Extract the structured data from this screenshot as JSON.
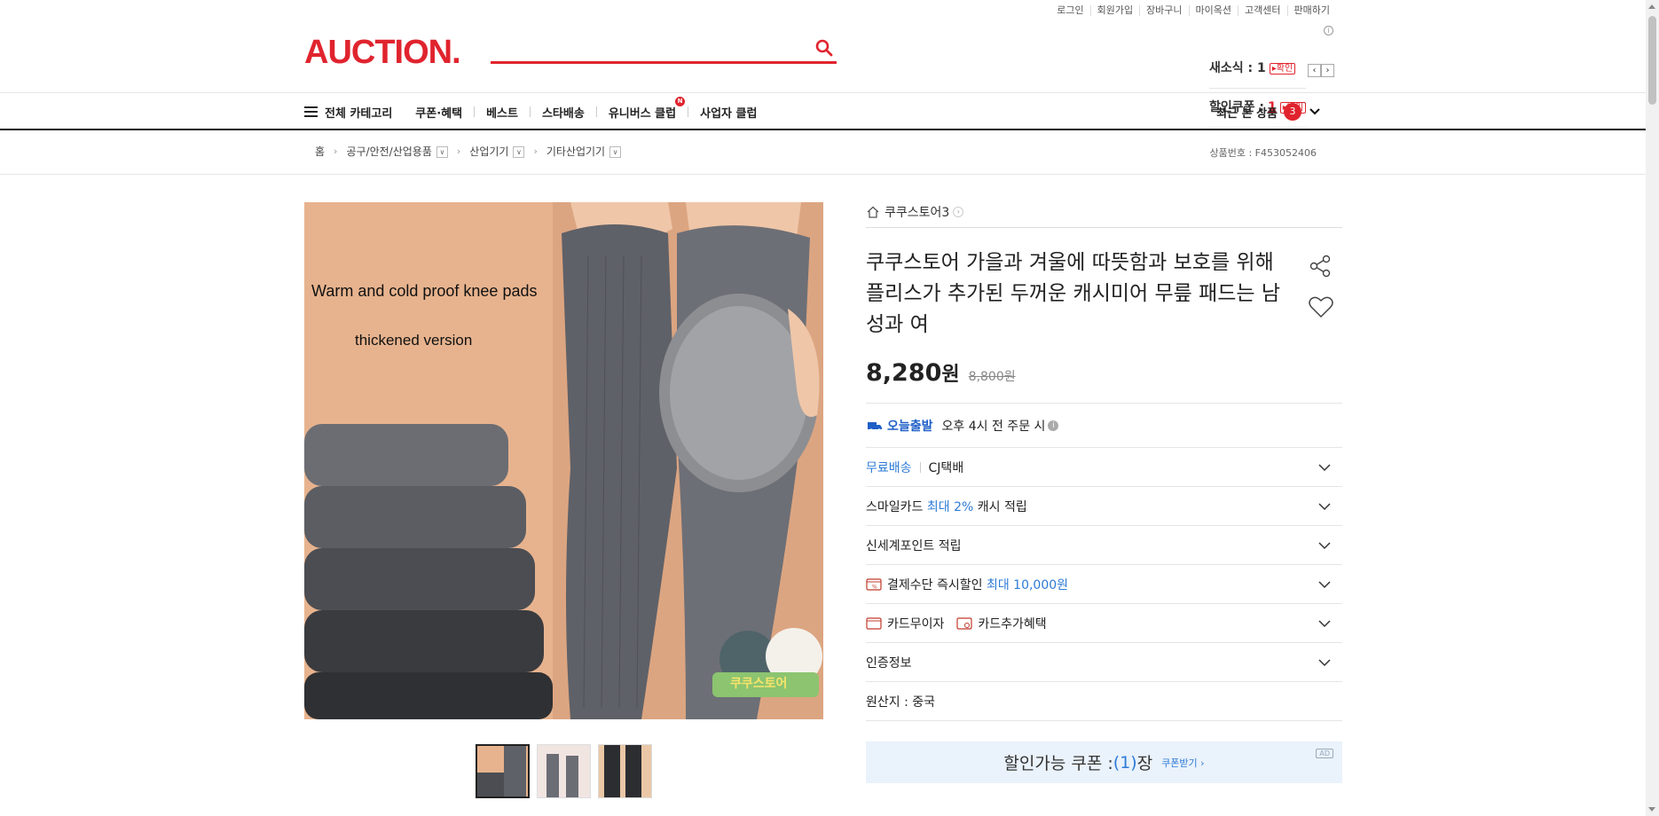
{
  "util_links": [
    "로그인",
    "회원가입",
    "장바구니",
    "마이옥션",
    "고객센터",
    "판매하기"
  ],
  "logo": "AUCTION.",
  "search": {
    "placeholder": ""
  },
  "mini": {
    "msg_label": "새소식 : 1",
    "msg_btn": "확인",
    "coupon_label": "할인쿠폰 :",
    "coupon_count": "1",
    "coupon_btn": "받기"
  },
  "nav": {
    "all_categories": "전체 카테고리",
    "items": [
      "쿠폰·혜택",
      "베스트",
      "스타배송",
      "유니버스 클럽",
      "사업자 클럽"
    ],
    "new_badge": "N",
    "recent_label": "최근 본 상품",
    "recent_count": "3"
  },
  "breadcrumb": {
    "home": "홈",
    "levels": [
      "공구/안전/산업용품",
      "산업기기",
      "기타산업기기"
    ]
  },
  "product_id": "상품번호 : F453052406",
  "image_text": {
    "line1": "Warm and cold proof knee pads",
    "line2": "thickened version",
    "brand_tag": "쿠쿠스토어"
  },
  "product": {
    "shop": "쿠쿠스토어3",
    "title": "쿠쿠스토어 가을과 겨울에 따뜻함과 보호를 위해 플리스가 추가된 두꺼운 캐시미어 무릎 패드는 남성과 여",
    "price": "8,280",
    "won": "원",
    "orig_price": "8,800원"
  },
  "rows": {
    "today_label": "오늘출발",
    "today_text": "오후 4시 전 주문 시",
    "free_ship": "무료배송",
    "courier": "CJ택배",
    "smile_a": "스마일카드",
    "smile_b": "최대 2%",
    "smile_c": "캐시 적립",
    "shinsegae": "신세계포인트 적립",
    "pay_a": "결제수단 즉시할인",
    "pay_b": "최대 10,000원",
    "card_free": "카드무이자",
    "card_extra": "카드추가혜택",
    "cert": "인증정보",
    "origin": "원산지 : 중국"
  },
  "coupon": {
    "label": "할인가능 쿠폰 : ",
    "count": "(1)",
    "unit": "장",
    "get": "쿠폰받기 ›",
    "ad": "AD"
  },
  "colors": {
    "brand": "#e0242e",
    "accent_blue": "#2e7bd6"
  }
}
